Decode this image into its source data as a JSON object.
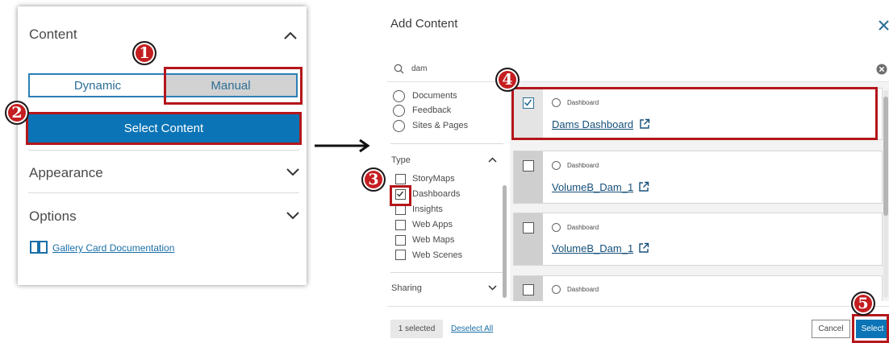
{
  "left_panel": {
    "content": {
      "title": "Content",
      "chevron": "chevron-up-icon"
    },
    "content_mode": {
      "dynamic_label": "Dynamic",
      "manual_label": "Manual",
      "selected": "Manual"
    },
    "select_content_label": "Select Content",
    "appearance": {
      "title": "Appearance",
      "chevron": "chevron-down-icon"
    },
    "options": {
      "title": "Options",
      "chevron": "chevron-down-icon"
    },
    "doc_link": {
      "label": "Gallery Card Documentation",
      "icon": "book-icon"
    }
  },
  "annotations": {
    "step1": "1",
    "step2": "2",
    "step3": "3",
    "step4": "4",
    "step5": "5",
    "accent": "#c41e21"
  },
  "dialog": {
    "title": "Add Content",
    "close_icon": "close-icon",
    "search": {
      "value": "dam",
      "icon": "search-icon",
      "clear_icon": "clear-icon"
    },
    "source_filters": [
      "Documents",
      "Feedback",
      "Sites & Pages"
    ],
    "type_filter": {
      "title": "Type",
      "options": [
        {
          "label": "StoryMaps",
          "checked": false
        },
        {
          "label": "Dashboards",
          "checked": true
        },
        {
          "label": "Insights",
          "checked": false
        },
        {
          "label": "Web Apps",
          "checked": false
        },
        {
          "label": "Web Maps",
          "checked": false
        },
        {
          "label": "Web Scenes",
          "checked": false
        }
      ]
    },
    "sharing": {
      "title": "Sharing"
    },
    "results": [
      {
        "type": "Dashboard",
        "title": "Dams Dashboard",
        "checked": true
      },
      {
        "type": "Dashboard",
        "title": "VolumeB_Dam_1",
        "checked": false
      },
      {
        "type": "Dashboard",
        "title": "VolumeB_Dam_1",
        "checked": false
      },
      {
        "type": "Dashboard",
        "title": "",
        "checked": false
      }
    ],
    "footer": {
      "selected_count": "1 selected",
      "deselect_all": "Deselect All",
      "cancel": "Cancel",
      "select": "Select"
    },
    "colors": {
      "primary": "#0a74b6",
      "link": "#15507a"
    }
  }
}
